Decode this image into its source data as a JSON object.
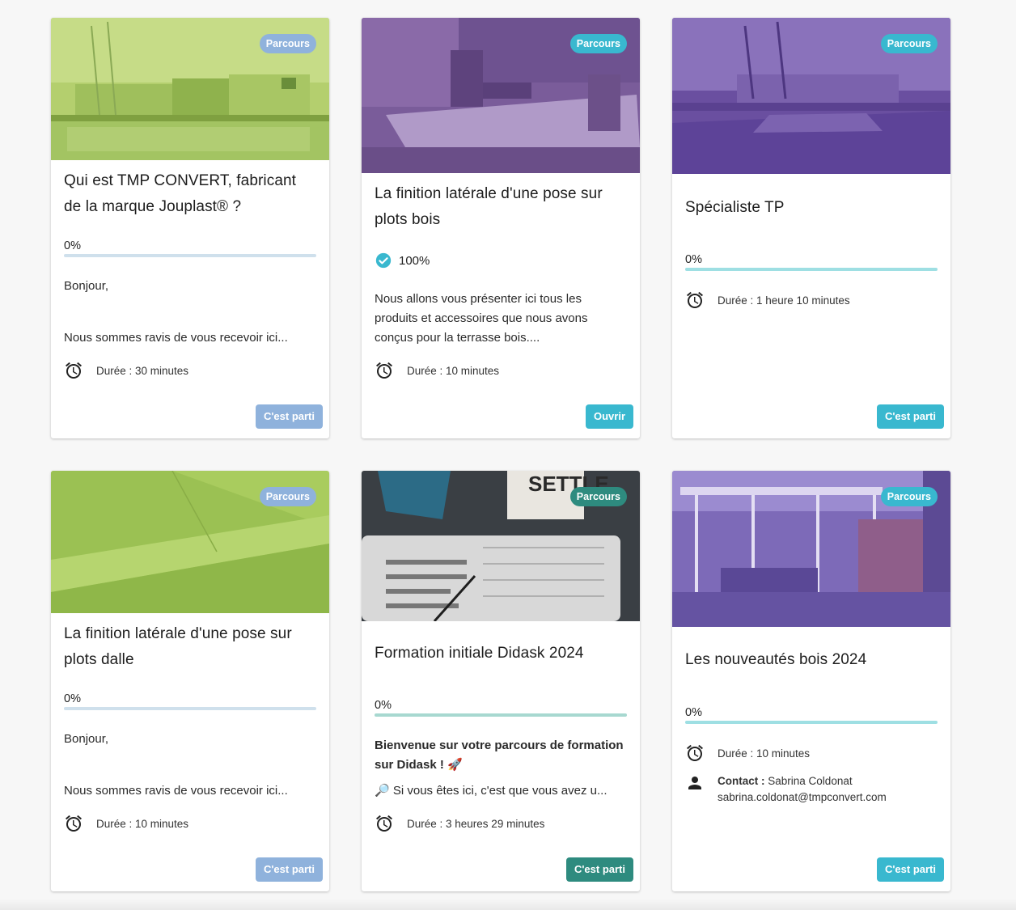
{
  "badge_label": "Parcours",
  "colors": {
    "blue_light": "#8fb2dc",
    "teal": "#39b8cf",
    "green_dark": "#2e8b7f",
    "bar_blue": "#cfe0ec",
    "bar_teal": "#9edfe3",
    "bar_green": "#a7d8d0"
  },
  "cards": [
    {
      "title": "Qui est TMP CONVERT, fabricant de la marque Jouplast® ?",
      "progress": "0%",
      "desc_line1": "Bonjour,",
      "desc_line2": "Nous sommes ravis de vous recevoir ici...",
      "duration": "Durée : 30 minutes",
      "button": "C'est parti"
    },
    {
      "title": "La finition latérale d'une pose sur plots bois",
      "progress": "100%",
      "desc": "Nous allons vous présenter ici tous les produits et accessoires que nous avons conçus pour la terrasse bois....",
      "duration": "Durée : 10 minutes",
      "button": "Ouvrir"
    },
    {
      "title": "Spécialiste TP",
      "progress": "0%",
      "duration": "Durée : 1 heure 10 minutes",
      "button": "C'est parti"
    },
    {
      "title": "La finition latérale d'une pose sur plots dalle",
      "progress": "0%",
      "desc_line1": "Bonjour,",
      "desc_line2": "Nous sommes ravis de vous recevoir ici...",
      "duration": "Durée : 10 minutes",
      "button": "C'est parti"
    },
    {
      "title": "Formation initiale Didask 2024",
      "progress": "0%",
      "desc_bold": "Bienvenue sur votre parcours de formation sur Didask ! 🚀",
      "desc_line2": "🔎 Si vous êtes ici, c'est que vous avez u...",
      "duration": "Durée : 3 heures 29 minutes",
      "button": "C'est parti",
      "image_text": "SETTLE"
    },
    {
      "title": "Les nouveautés bois 2024",
      "progress": "0%",
      "duration": "Durée : 10 minutes",
      "contact_label": "Contact :",
      "contact_name": "Sabrina Coldonat",
      "contact_email": "sabrina.coldonat@tmpconvert.com",
      "button": "C'est parti"
    }
  ]
}
